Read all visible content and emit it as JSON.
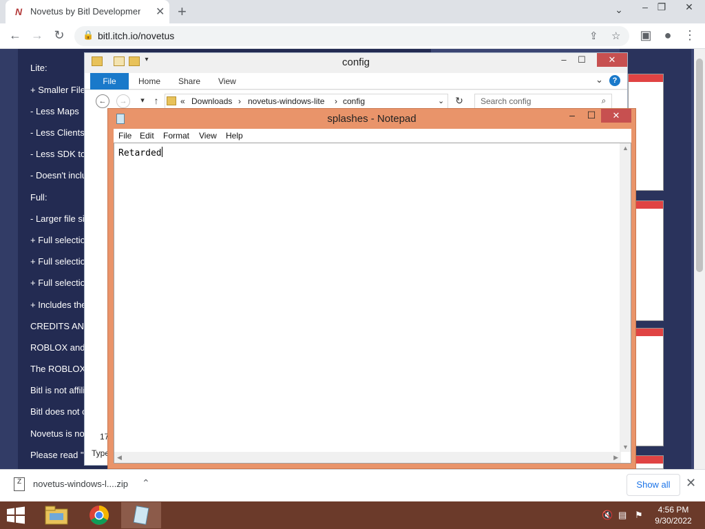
{
  "browser": {
    "tab_title": "Novetus by Bitl Development Stu",
    "tab_favicon": "N",
    "url": "bitl.itch.io/novetus"
  },
  "page": {
    "lines": [
      "Lite:",
      "+ Smaller File",
      "- Less Maps",
      "- Less Clients",
      "- Less SDK to",
      "- Doesn't inclu",
      "Full:",
      "- Larger file si",
      "+ Full selectio",
      "+ Full selectio",
      "+ Full selectio",
      "+ Includes the",
      "CREDITS AN",
      "ROBLOX and",
      "The ROBLOX",
      "Bitl is not affili",
      "Bitl does not c",
      "Novetus is no",
      "Please read \""
    ]
  },
  "explorer": {
    "title": "config",
    "ribbon_tabs": [
      "File",
      "Home",
      "Share",
      "View"
    ],
    "breadcrumb_prefix": "«",
    "breadcrumb": [
      "Downloads",
      "novetus-windows-lite",
      "config"
    ],
    "search_placeholder": "Search config",
    "status_count": "17",
    "type_label": "Type"
  },
  "notepad": {
    "title": "splashes - Notepad",
    "menu": [
      "File",
      "Edit",
      "Format",
      "View",
      "Help"
    ],
    "content": "Retarded"
  },
  "download": {
    "filename": "novetus-windows-l....zip",
    "show_all": "Show all"
  },
  "taskbar": {
    "time": "4:56 PM",
    "date": "9/30/2022"
  },
  "colors": {
    "notepad_frame": "#e9946a",
    "taskbar": "#6b3a2a",
    "page_bg": "#232b52",
    "close_red": "#c75050",
    "explorer_file_tab": "#1979ca"
  }
}
